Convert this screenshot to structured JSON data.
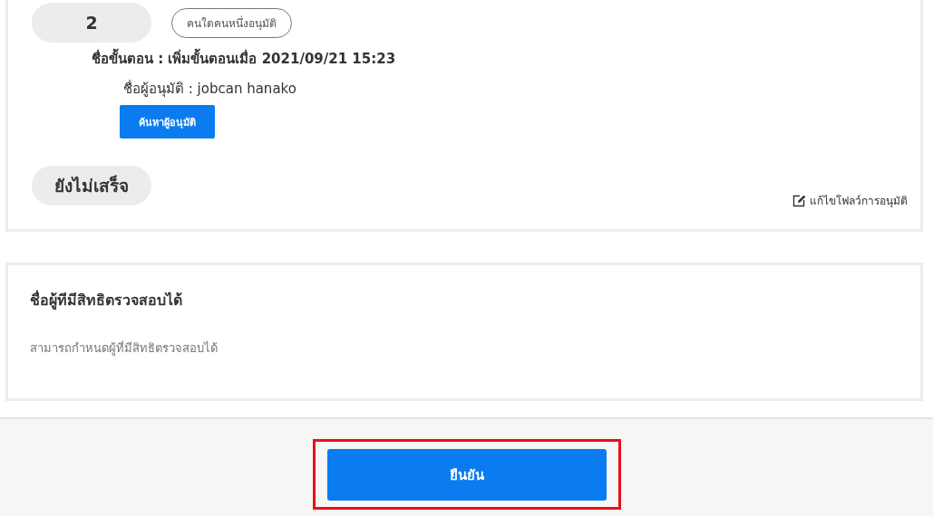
{
  "step": {
    "number": "2",
    "mode": "คนใดคนหนึ่งอนุมัติ",
    "name": "ชื่อขั้นตอน : เพิ่มขั้นตอนเมื่อ 2021/09/21 15:23",
    "approver": "ชื่อผู้อนุมัติ : jobcan hanako",
    "search_button": "ค้นหาผู้อนุมัติ",
    "status": "ยังไม่เสร็จ",
    "edit_link": "แก้ไขโฟลว์การอนุมัติ"
  },
  "viewers": {
    "title": "ชื่อผู้ทีมีสิทธิตรวจสอบได้",
    "description": "สามารถกำหนดผู้ที่มีสิทธิตรวจสอบได้"
  },
  "footer": {
    "confirm_button": "ยืนยัน",
    "highlighted": true
  }
}
